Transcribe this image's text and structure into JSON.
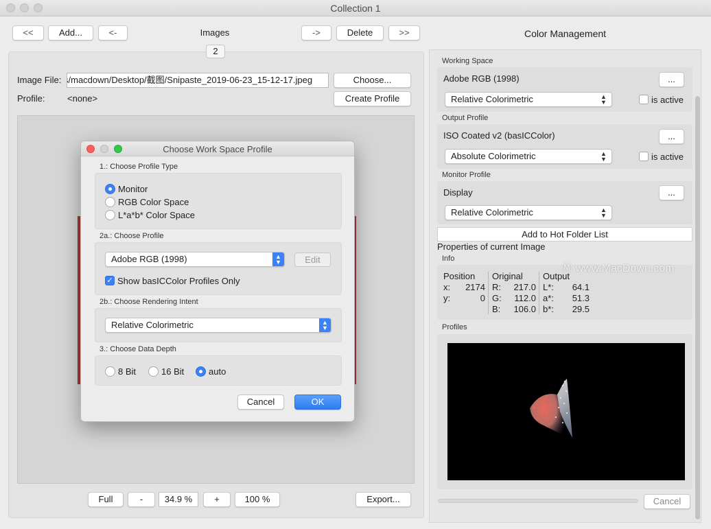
{
  "window": {
    "title": "Collection 1"
  },
  "toolbar": {
    "first": "<<",
    "add": "Add...",
    "prev": "<-",
    "images": "Images",
    "next": "->",
    "delete": "Delete",
    "last": ">>",
    "count": "2"
  },
  "file": {
    "image_file_label": "Image File:",
    "image_file_value": "s/macdown/Desktop/截图/Snipaste_2019-06-23_15-12-17.jpeg",
    "choose": "Choose...",
    "profile_label": "Profile:",
    "profile_value": "<none>",
    "create_profile": "Create Profile"
  },
  "bottom": {
    "full": "Full",
    "minus": "-",
    "zoom": "34.9 %",
    "plus": "+",
    "hundred": "100 %",
    "export": "Export..."
  },
  "dialog": {
    "title": "Choose Work Space Profile",
    "sec1": "1.: Choose Profile Type",
    "type_options": [
      "Monitor",
      "RGB Color Space",
      "L*a*b* Color Space"
    ],
    "type_selected": "Monitor",
    "sec2a": "2a.: Choose Profile",
    "profile_value": "Adobe RGB (1998)",
    "edit": "Edit",
    "show_basic": "Show basICColor Profiles Only",
    "show_basic_checked": true,
    "sec2b": "2b.: Choose Rendering Intent",
    "intent_value": "Relative Colorimetric",
    "sec3": "3.: Choose Data Depth",
    "depth_options": [
      "8 Bit",
      "16 Bit",
      "auto"
    ],
    "depth_selected": "auto",
    "cancel": "Cancel",
    "ok": "OK"
  },
  "color_management": {
    "title": "Color Management",
    "working_space": {
      "label": "Working Space",
      "value": "Adobe RGB (1998)",
      "more": "...",
      "intent": "Relative Colorimetric",
      "is_active": "is active"
    },
    "output_profile": {
      "label": "Output Profile",
      "value": "ISO Coated v2 (basICColor)",
      "more": "...",
      "intent": "Absolute Colorimetric",
      "is_active": "is active"
    },
    "monitor_profile": {
      "label": "Monitor Profile",
      "value": "Display",
      "more": "...",
      "intent": "Relative Colorimetric"
    },
    "hot_folder": "Add to Hot Folder List",
    "properties": "Properties of current Image",
    "info_label": "Info",
    "info": {
      "position_header": "Position",
      "original_header": "Original",
      "output_header": "Output",
      "x_label": "x:",
      "x_value": "2174",
      "y_label": "y:",
      "y_value": "0",
      "r_label": "R:",
      "r_value": "217.0",
      "g_label": "G:",
      "g_value": "112.0",
      "b_label": "B:",
      "b_value": "106.0",
      "l_label": "L*:",
      "l_value": "64.1",
      "a_label": "a*:",
      "a_value": "51.3",
      "bb_label": "b*:",
      "bb_value": "29.5"
    },
    "profiles_label": "Profiles",
    "cancel": "Cancel"
  },
  "watermark": "www.MacDown.com"
}
